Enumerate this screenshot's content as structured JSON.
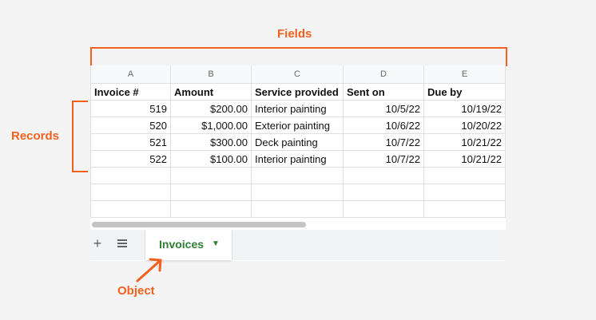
{
  "callouts": {
    "fields": "Fields",
    "records": "Records",
    "object": "Object"
  },
  "colors": {
    "annotation": "#f2611d",
    "tab_text": "#2e7d32"
  },
  "sheet": {
    "column_headers": [
      "A",
      "B",
      "C",
      "D",
      "E"
    ],
    "fields": [
      "Invoice #",
      "Amount",
      "Service provided",
      "Sent on",
      "Due by"
    ],
    "records": [
      [
        "519",
        "$200.00",
        "Interior painting",
        "10/5/22",
        "10/19/22"
      ],
      [
        "520",
        "$1,000.00",
        "Exterior painting",
        "10/6/22",
        "10/20/22"
      ],
      [
        "521",
        "$300.00",
        "Deck painting",
        "10/7/22",
        "10/21/22"
      ],
      [
        "522",
        "$100.00",
        "Interior painting",
        "10/7/22",
        "10/21/22"
      ]
    ],
    "tab_label": "Invoices",
    "icons": {
      "add": "plus-icon",
      "all_sheets": "list-icon",
      "tab_menu": "caret-down-icon",
      "arrow": "arrow-icon"
    }
  }
}
